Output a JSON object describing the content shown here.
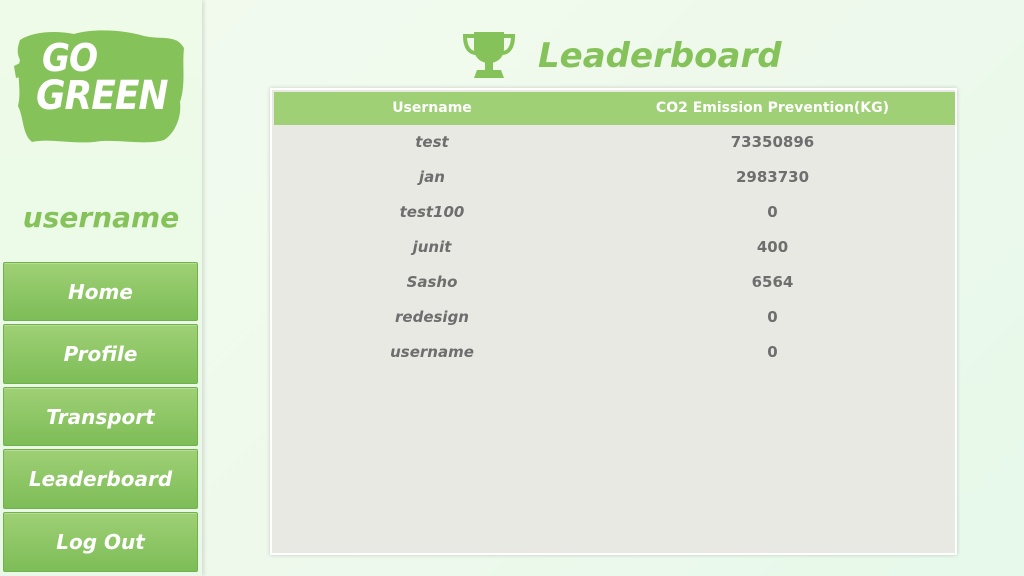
{
  "logo": {
    "line1": "GO",
    "line2": "GREEN",
    "brand_color": "#86c25a"
  },
  "sidebar": {
    "username": "username",
    "nav": [
      {
        "label": "Home"
      },
      {
        "label": "Profile"
      },
      {
        "label": "Transport"
      },
      {
        "label": "Leaderboard"
      },
      {
        "label": "Log Out"
      }
    ]
  },
  "header": {
    "title": "Leaderboard",
    "icon": "trophy-icon"
  },
  "table": {
    "columns": [
      "Username",
      "CO2 Emission Prevention(KG)"
    ],
    "rows": [
      {
        "username": "test",
        "co2": "73350896"
      },
      {
        "username": "jan",
        "co2": "2983730"
      },
      {
        "username": "test100",
        "co2": "0"
      },
      {
        "username": "junit",
        "co2": "400"
      },
      {
        "username": "Sasho",
        "co2": "6564"
      },
      {
        "username": "redesign",
        "co2": "0"
      },
      {
        "username": "username",
        "co2": "0"
      }
    ]
  },
  "colors": {
    "accent": "#86c25a",
    "header_bg": "#9fd076",
    "panel_bg": "#e9e9e4",
    "text_gray": "#6e6e6e"
  }
}
